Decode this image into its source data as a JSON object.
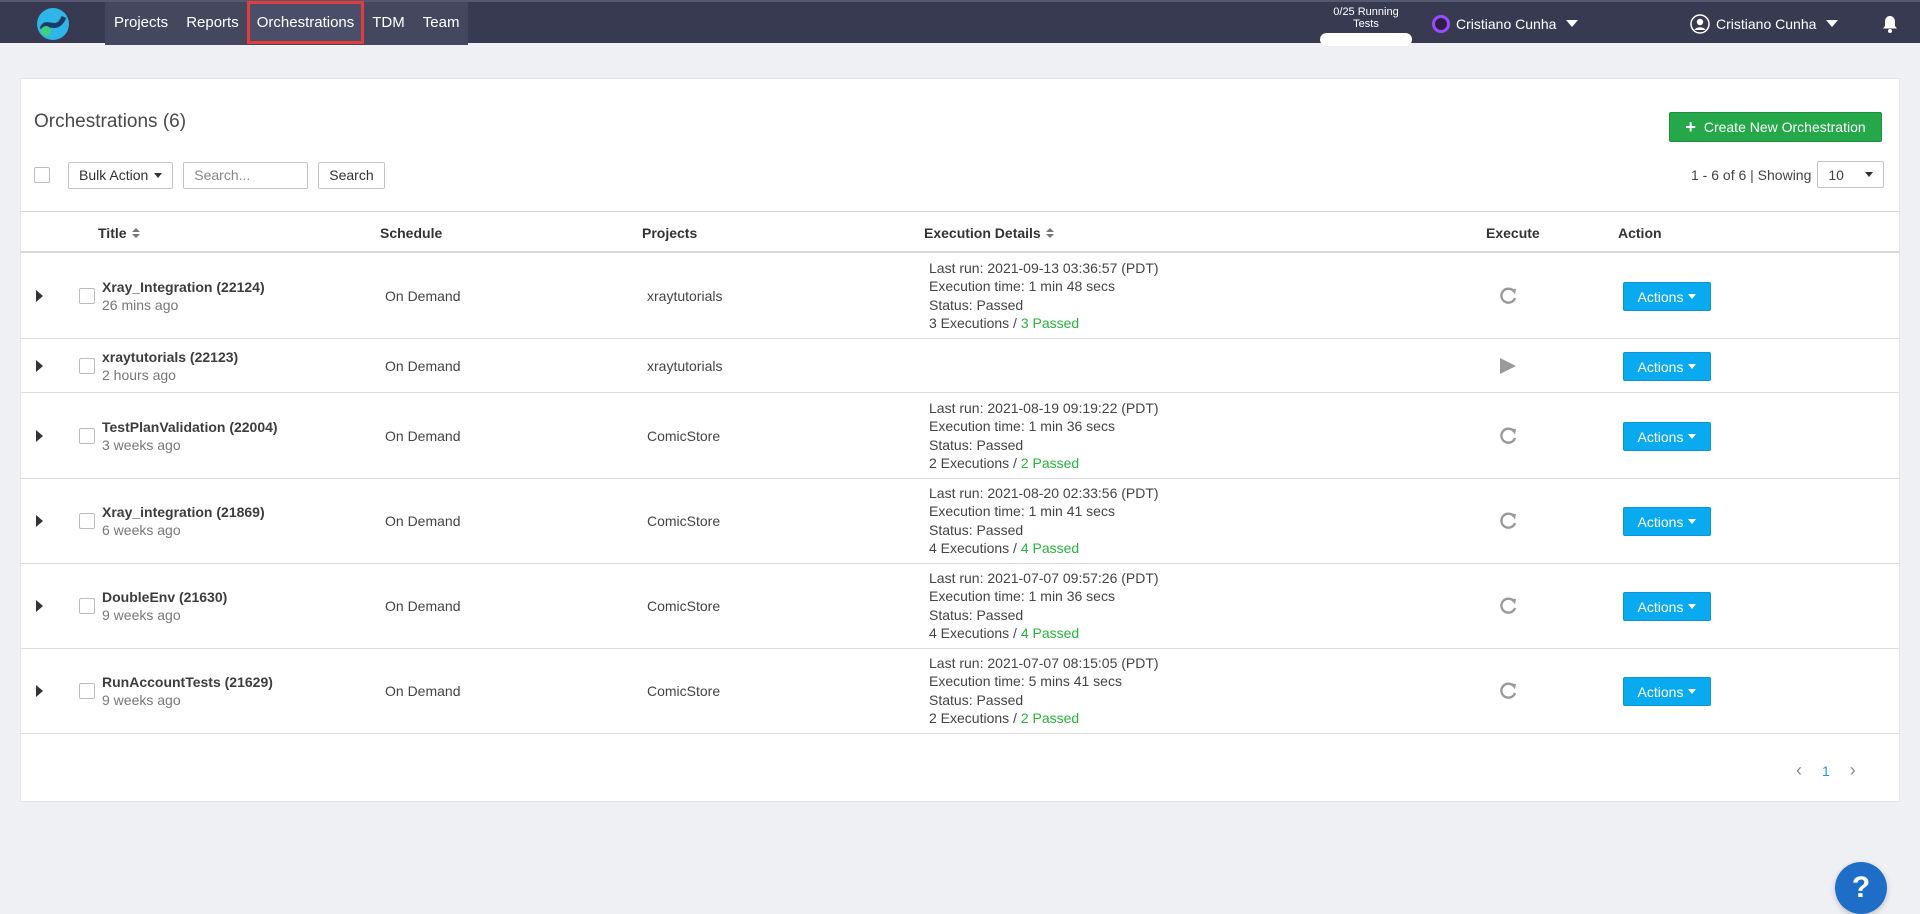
{
  "nav": {
    "tabs": [
      {
        "label": "Projects"
      },
      {
        "label": "Reports"
      },
      {
        "label": "Orchestrations",
        "active": true
      },
      {
        "label": "TDM"
      },
      {
        "label": "Team"
      }
    ],
    "running_tests": "0/25 Running Tests",
    "org_name": "Cristiano Cunha",
    "user_name": "Cristiano Cunha"
  },
  "page": {
    "title": "Orchestrations (6)",
    "create_button": "Create New Orchestration",
    "bulk_action": "Bulk Action",
    "search_placeholder": "Search...",
    "search_button": "Search",
    "pager_info": "1 - 6 of 6 | Showing",
    "page_size": "10",
    "current_page": "1"
  },
  "table": {
    "headers": {
      "title": "Title",
      "schedule": "Schedule",
      "projects": "Projects",
      "execution_details": "Execution Details",
      "execute": "Execute",
      "action": "Action"
    },
    "actions_label": "Actions",
    "rows": [
      {
        "name": "Xray_Integration (22124)",
        "time": "26 mins ago",
        "schedule": "On Demand",
        "project": "xraytutorials",
        "last_run": "Last run: 2021-09-13 03:36:57 (PDT)",
        "exec_time": "Execution time: 1 min 48 secs",
        "status": "Status: Passed",
        "executions": "3 Executions",
        "passed": "3 Passed",
        "execute_icon": "refresh-icon"
      },
      {
        "name": "xraytutorials (22123)",
        "time": "2 hours ago",
        "schedule": "On Demand",
        "project": "xraytutorials",
        "last_run": "",
        "exec_time": "",
        "status": "",
        "executions": "",
        "passed": "",
        "execute_icon": "play-icon"
      },
      {
        "name": "TestPlanValidation (22004)",
        "time": "3 weeks ago",
        "schedule": "On Demand",
        "project": "ComicStore",
        "last_run": "Last run: 2021-08-19 09:19:22 (PDT)",
        "exec_time": "Execution time: 1 min 36 secs",
        "status": "Status: Passed",
        "executions": "2 Executions",
        "passed": "2 Passed",
        "execute_icon": "refresh-icon"
      },
      {
        "name": "Xray_integration (21869)",
        "time": "6 weeks ago",
        "schedule": "On Demand",
        "project": "ComicStore",
        "last_run": "Last run: 2021-08-20 02:33:56 (PDT)",
        "exec_time": "Execution time: 1 min 41 secs",
        "status": "Status: Passed",
        "executions": "4 Executions",
        "passed": "4 Passed",
        "execute_icon": "refresh-icon"
      },
      {
        "name": "DoubleEnv (21630)",
        "time": "9 weeks ago",
        "schedule": "On Demand",
        "project": "ComicStore",
        "last_run": "Last run: 2021-07-07 09:57:26 (PDT)",
        "exec_time": "Execution time: 1 min 36 secs",
        "status": "Status: Passed",
        "executions": "4 Executions",
        "passed": "4 Passed",
        "execute_icon": "refresh-icon"
      },
      {
        "name": "RunAccountTests (21629)",
        "time": "9 weeks ago",
        "schedule": "On Demand",
        "project": "ComicStore",
        "last_run": "Last run: 2021-07-07 08:15:05 (PDT)",
        "exec_time": "Execution time: 5 mins 41 secs",
        "status": "Status: Passed",
        "executions": "2 Executions",
        "passed": "2 Passed",
        "execute_icon": "refresh-icon"
      }
    ]
  },
  "help_label": "?",
  "colors": {
    "topbar": "#383a52",
    "create_button": "#25a84a",
    "actions_button": "#0aaaf0",
    "passed_text": "#27b53a",
    "highlight": "#e23c3c"
  }
}
